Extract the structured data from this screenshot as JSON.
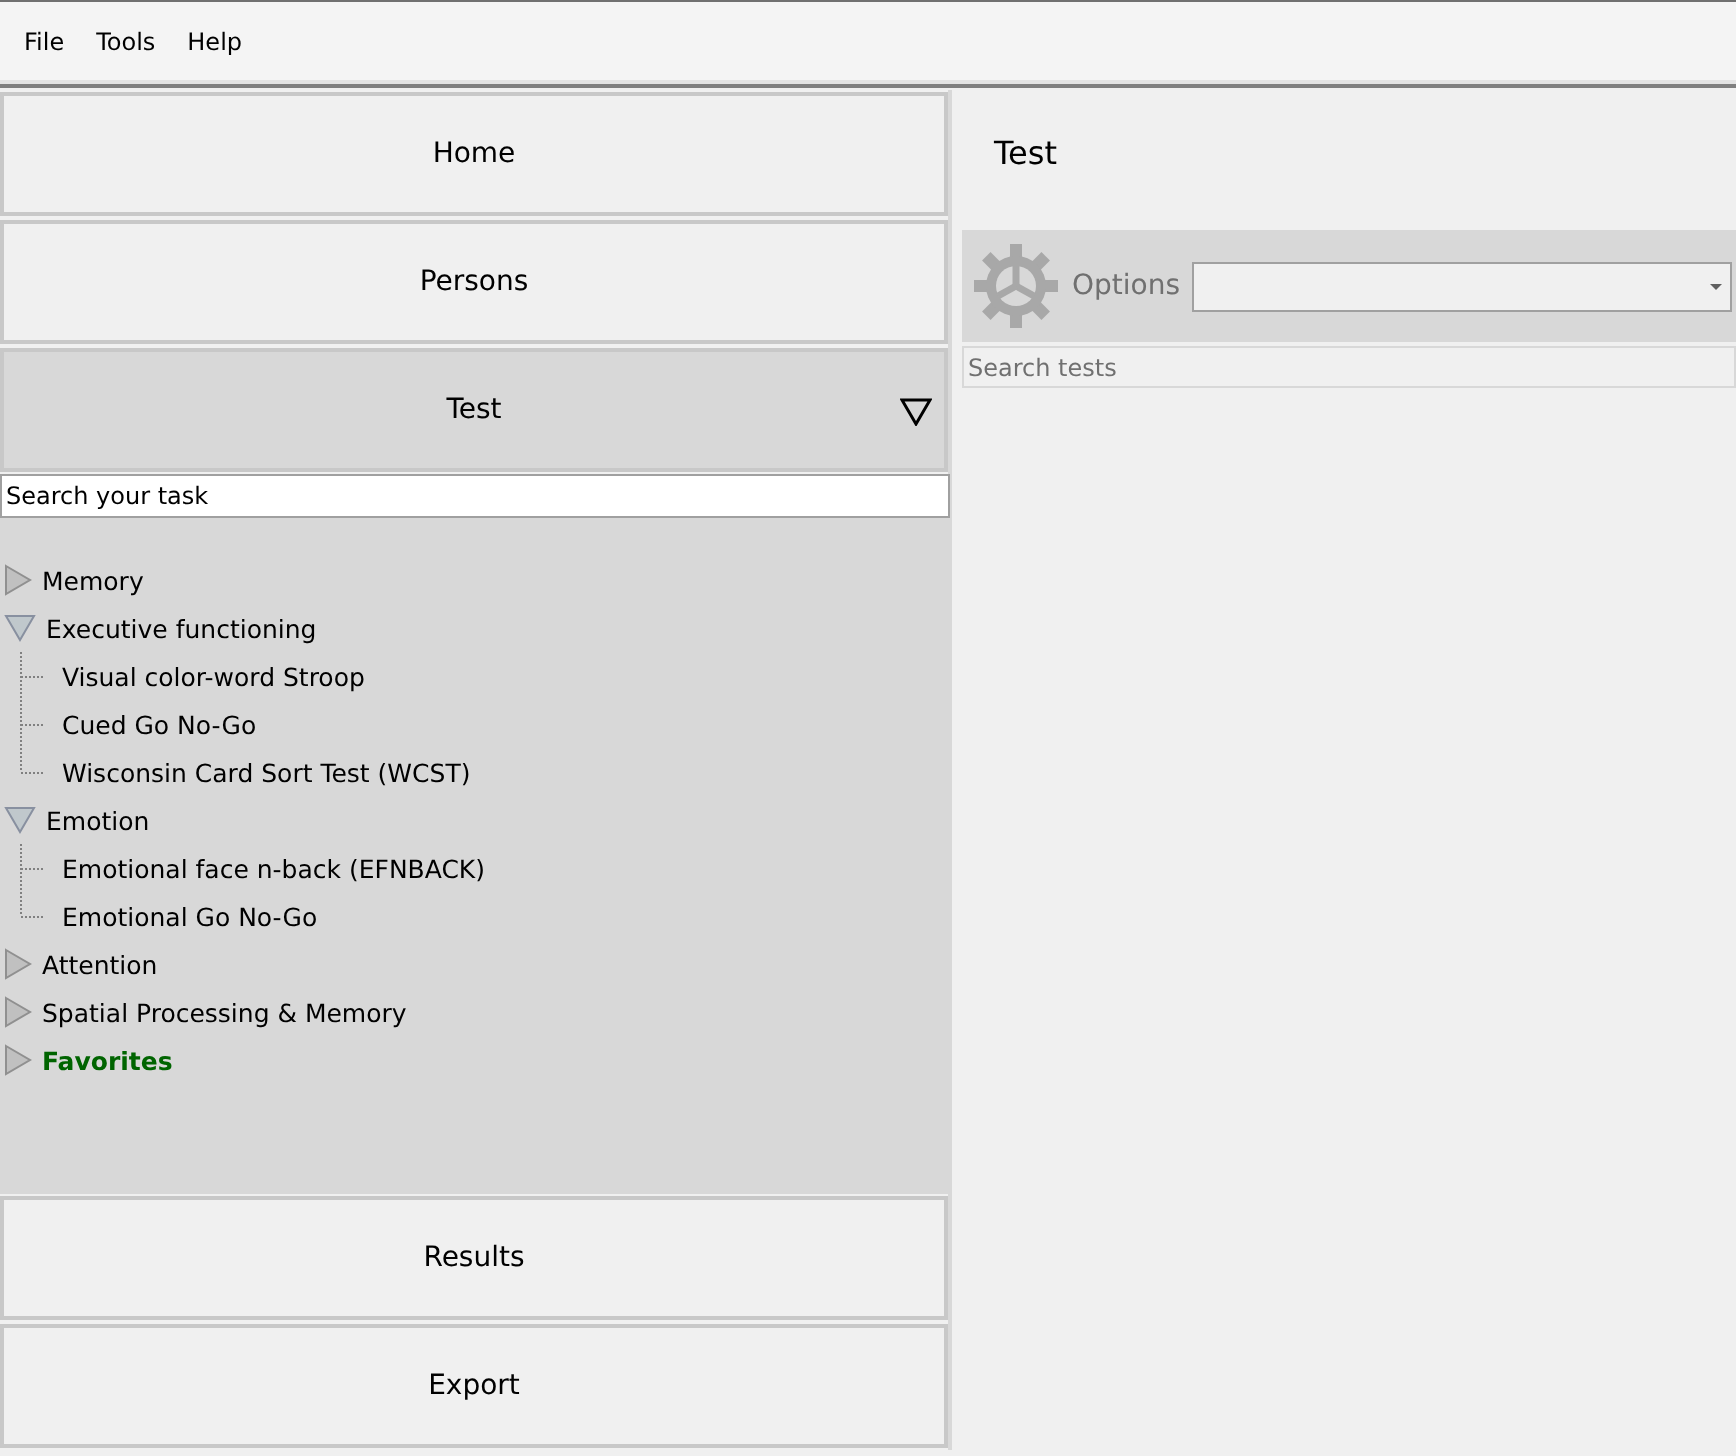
{
  "menu": [
    "File",
    "Tools",
    "Help"
  ],
  "nav_top": [
    {
      "label": "Home",
      "selected": false
    },
    {
      "label": "Persons",
      "selected": false
    },
    {
      "label": "Test",
      "selected": true,
      "expanded": true
    }
  ],
  "task_search": {
    "value": "Search your task"
  },
  "tree": [
    {
      "label": "Memory",
      "kind": "category",
      "expanded": false
    },
    {
      "label": "Executive functioning",
      "kind": "category",
      "expanded": true,
      "children": [
        {
          "label": "Visual color-word Stroop"
        },
        {
          "label": "Cued Go No-Go"
        },
        {
          "label": "Wisconsin Card Sort Test (WCST)"
        }
      ]
    },
    {
      "label": "Emotion",
      "kind": "category",
      "expanded": true,
      "children": [
        {
          "label": "Emotional face n-back (EFNBACK)"
        },
        {
          "label": "Emotional Go No-Go"
        }
      ]
    },
    {
      "label": "Attention",
      "kind": "category",
      "expanded": false
    },
    {
      "label": "Spatial Processing & Memory",
      "kind": "category",
      "expanded": false
    },
    {
      "label": "Favorites",
      "kind": "favorites",
      "expanded": false
    }
  ],
  "nav_bottom": [
    {
      "label": "Results",
      "selected": false
    },
    {
      "label": "Export",
      "selected": false
    }
  ],
  "panel": {
    "title": "Test",
    "options_label": "Options",
    "search": {
      "placeholder": "Search tests"
    }
  }
}
